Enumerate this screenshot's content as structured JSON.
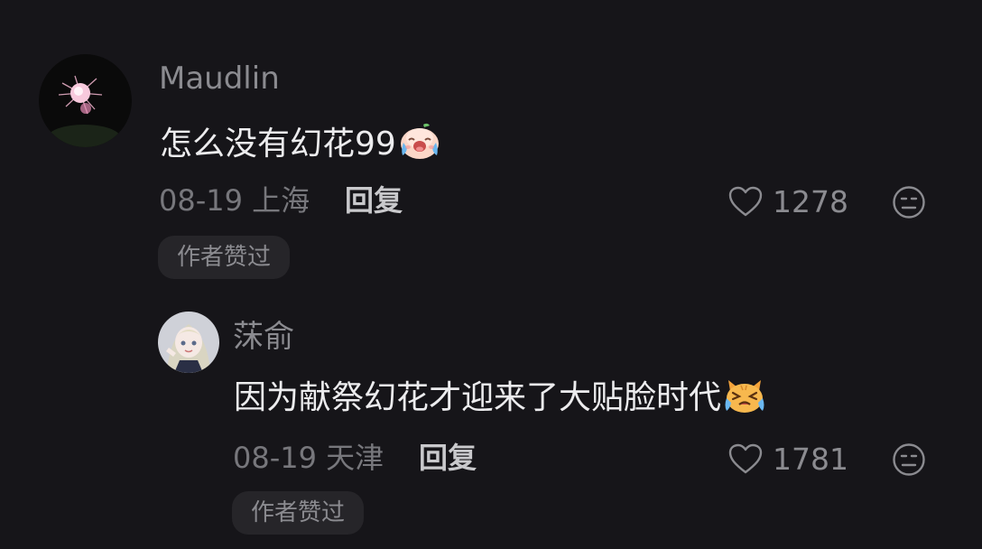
{
  "comments": [
    {
      "username": "Maudlin",
      "text": "怎么没有幻花99",
      "emoji": "crying-face-emoji",
      "date_location": "08-19 上海",
      "reply_label": "回复",
      "likes": "1278",
      "badge": "作者赞过"
    },
    {
      "username": "莯俞",
      "text": "因为献祭幻花才迎来了大贴脸时代",
      "emoji": "crying-cat-emoji",
      "date_location": "08-19 天津",
      "reply_label": "回复",
      "likes": "1781",
      "badge": "作者赞过"
    }
  ],
  "colors": {
    "background": "#161519",
    "text": "#ececee",
    "muted": "#8b8b90",
    "badge_bg": "#262529"
  }
}
